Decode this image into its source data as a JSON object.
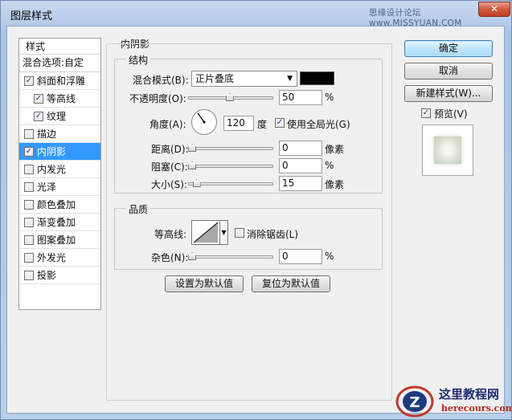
{
  "window": {
    "title": "图层样式",
    "watermark_top": "思缘设计论坛 www.MISSYUAN.COM",
    "close_glyph": "✕"
  },
  "style_list": {
    "header": "样式",
    "blend_options": "混合选项:自定",
    "items": [
      {
        "label": "斜面和浮雕",
        "checked": true,
        "sub": false,
        "active": false
      },
      {
        "label": "等高线",
        "checked": true,
        "sub": true,
        "active": false
      },
      {
        "label": "纹理",
        "checked": true,
        "sub": true,
        "active": false
      },
      {
        "label": "描边",
        "checked": false,
        "sub": false,
        "active": false
      },
      {
        "label": "内阴影",
        "checked": true,
        "sub": false,
        "active": true
      },
      {
        "label": "内发光",
        "checked": false,
        "sub": false,
        "active": false
      },
      {
        "label": "光泽",
        "checked": false,
        "sub": false,
        "active": false
      },
      {
        "label": "颜色叠加",
        "checked": false,
        "sub": false,
        "active": false
      },
      {
        "label": "渐变叠加",
        "checked": false,
        "sub": false,
        "active": false
      },
      {
        "label": "图案叠加",
        "checked": false,
        "sub": false,
        "active": false
      },
      {
        "label": "外发光",
        "checked": false,
        "sub": false,
        "active": false
      },
      {
        "label": "投影",
        "checked": false,
        "sub": false,
        "active": false
      }
    ]
  },
  "inner_shadow": {
    "section_title": "内阴影",
    "structure": {
      "title": "结构",
      "blend_mode_label": "混合模式(B):",
      "blend_mode_value": "正片叠底",
      "shadow_color": "#000000",
      "opacity_label": "不透明度(O):",
      "opacity_value": "50",
      "opacity_unit": "%",
      "angle_label": "角度(A):",
      "angle_value": "120",
      "angle_unit": "度",
      "global_light_label": "使用全局光(G)",
      "global_light_checked": true,
      "distance_label": "距离(D):",
      "distance_value": "0",
      "distance_unit": "像素",
      "choke_label": "阻塞(C):",
      "choke_value": "0",
      "choke_unit": "%",
      "size_label": "大小(S):",
      "size_value": "15",
      "size_unit": "像素"
    },
    "quality": {
      "title": "品质",
      "contour_label": "等高线:",
      "anti_alias_label": "消除锯齿(L)",
      "anti_alias_checked": false,
      "noise_label": "杂色(N):",
      "noise_value": "0",
      "noise_unit": "%"
    },
    "make_default": "设置为默认值",
    "reset_default": "复位为默认值"
  },
  "buttons": {
    "ok": "确定",
    "cancel": "取消",
    "new_style": "新建样式(W)...",
    "preview_label": "预览(V)",
    "preview_checked": true
  },
  "watermark_bottom": {
    "title": "这里教程网",
    "url": "herecours.com"
  }
}
